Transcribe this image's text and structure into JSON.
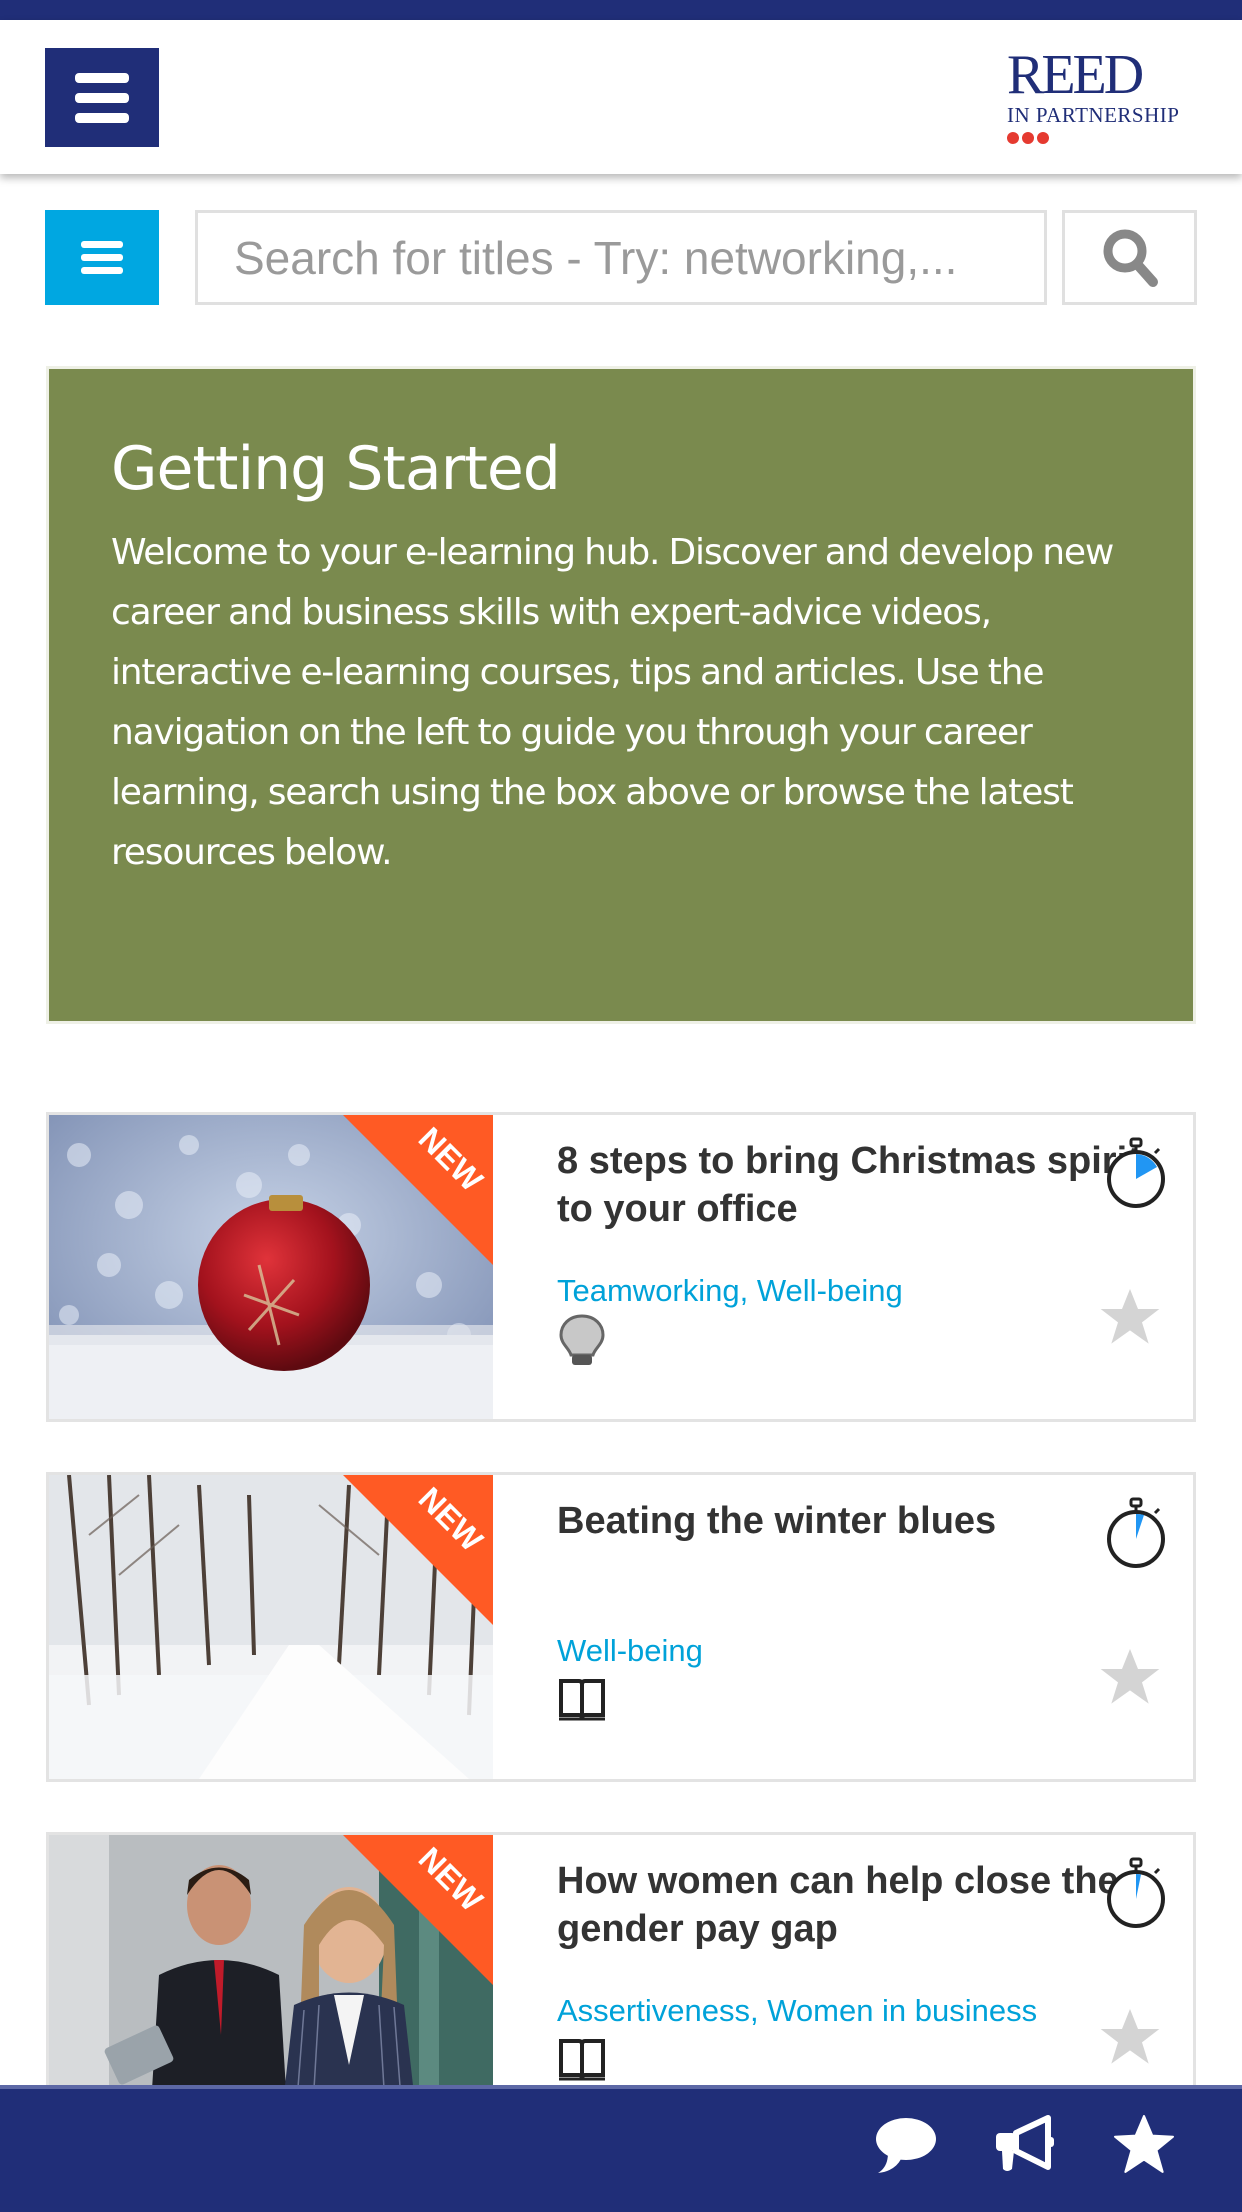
{
  "header": {
    "menu_icon": "hamburger-menu-icon",
    "logo": {
      "brand": "REED",
      "tagline": "IN PARTNERSHIP"
    }
  },
  "search": {
    "nav_icon": "list-menu-icon",
    "placeholder": "Search for titles - Try: networking,...",
    "value": "",
    "button_icon": "search-icon"
  },
  "intro": {
    "title": "Getting Started",
    "body": "Welcome to your e-learning hub. Discover and develop new career and business skills with expert-advice videos, interactive e-learning courses, tips and articles. Use the navigation on the left to guide you through your career learning, search using the box above or browse the latest resources below."
  },
  "resources": [
    {
      "title": "8 steps to bring Christmas spirit to your office",
      "tags": "Teamworking, Well-being",
      "badge": "NEW",
      "type_icon": "lightbulb-icon",
      "image": "christmas-bauble-in-snow"
    },
    {
      "title": "Beating the winter blues",
      "tags": "Well-being",
      "badge": "NEW",
      "type_icon": "book-icon",
      "image": "snowy-tree-lined-road"
    },
    {
      "title": "How women can help close the gender pay gap",
      "tags": "Assertiveness, Women in business",
      "badge": "NEW",
      "type_icon": "book-icon",
      "image": "businesswoman-and-colleague"
    }
  ],
  "bottom_bar": {
    "icons": [
      "chat-bubble-icon",
      "megaphone-icon",
      "star-icon"
    ]
  },
  "colors": {
    "navy": "#202e78",
    "accent_blue": "#00a7e1",
    "intro_green": "#7a8a4e",
    "badge_orange": "#ff5a24",
    "tag_blue": "#00a2d9",
    "logo_dots": "#e53a30"
  }
}
